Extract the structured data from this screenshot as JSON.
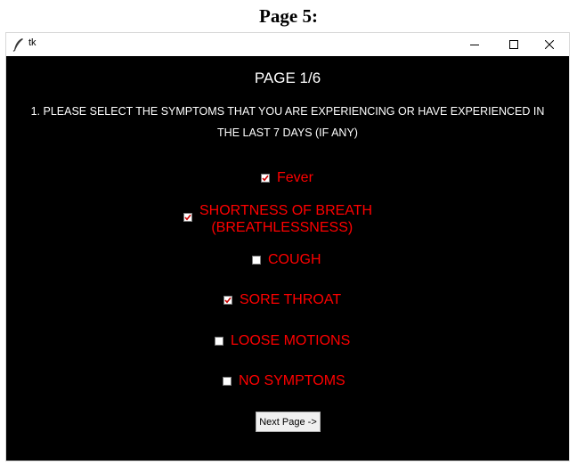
{
  "caption": "Page 5:",
  "window": {
    "title": "tk",
    "minimize_glyph": "minimize-icon",
    "maximize_glyph": "maximize-icon",
    "close_glyph": "close-icon"
  },
  "content": {
    "page_heading": "PAGE 1/6",
    "question_line1": "1. PLEASE SELECT THE SYMPTOMS THAT YOU ARE EXPERIENCING OR HAVE EXPERIENCED IN",
    "question_line2": "THE LAST 7 DAYS (IF ANY)",
    "options": [
      {
        "label": "Fever",
        "checked": true
      },
      {
        "label": "SHORTNESS OF BREATH\n   (BREATHLESSNESS)",
        "checked": true
      },
      {
        "label": "COUGH",
        "checked": false
      },
      {
        "label": "SORE THROAT",
        "checked": true
      },
      {
        "label": "LOOSE MOTIONS",
        "checked": false
      },
      {
        "label": "NO SYMPTOMS",
        "checked": false
      }
    ],
    "next_button": "Next Page ->"
  },
  "colors": {
    "background": "#000000",
    "option_text": "#ff0000",
    "heading_text": "#ffffff",
    "check_mark": "#cc0000"
  }
}
